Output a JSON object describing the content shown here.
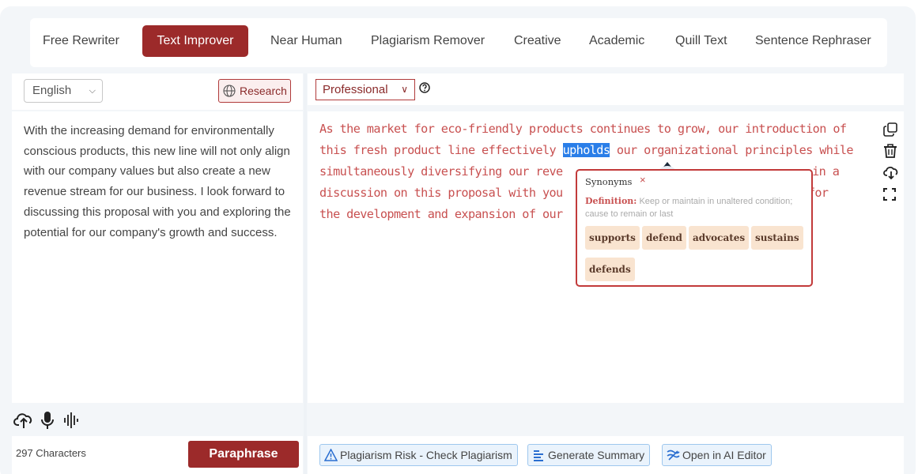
{
  "tabs": [
    {
      "label": "Free Rewriter",
      "active": false
    },
    {
      "label": "Text Improver",
      "active": true
    },
    {
      "label": "Near Human",
      "active": false
    },
    {
      "label": "Plagiarism Remover",
      "active": false
    },
    {
      "label": "Creative",
      "active": false
    },
    {
      "label": "Academic",
      "active": false
    },
    {
      "label": "Quill Text",
      "active": false
    },
    {
      "label": "Sentence Rephraser",
      "active": false
    }
  ],
  "left": {
    "language": "English",
    "research_label": "Research",
    "input_text": "With the increasing demand for environmentally conscious products, this new line will not only align with our company values but also create a new revenue stream for our business. I look forward to discussing this proposal with you and exploring the potential for our company's growth and success.",
    "char_count": "297 Characters",
    "paraphrase_label": "Paraphrase",
    "icons": [
      "upload-cloud-icon",
      "microphone-icon",
      "audio-wave-icon"
    ]
  },
  "right": {
    "tone": "Professional",
    "output": {
      "line1": "As the market for eco-friendly products continues to grow, our introduction of",
      "line2_a": "this fresh product line effectively ",
      "highlighted": "upholds",
      "line2_b": " our organizational principles while",
      "line3_a": "simultaneously diversifying our reve",
      "line3_b": " in a",
      "line4_a": "discussion on this proposal with you",
      "line4_b": "ities for",
      "line5": "the development and expansion of our"
    },
    "side_icons": [
      "copy-icon",
      "trash-icon",
      "download-icon",
      "fullscreen-icon"
    ],
    "actions": {
      "plagiarism": "Plagiarism Risk - Check Plagiarism",
      "summary": "Generate Summary",
      "editor": "Open in AI Editor"
    }
  },
  "popup": {
    "title": "Synonyms",
    "close": "×",
    "definition_label": "Definition:",
    "definition_text": "Keep or maintain in unaltered condition; cause to remain or last",
    "synonyms": [
      "supports",
      "defend",
      "advocates",
      "sustains",
      "defends"
    ]
  },
  "colors": {
    "brand": "#9c2a2a",
    "output_text": "#c85050",
    "highlight": "#2a7ee8",
    "synonym_chip": "#f9e4d0"
  }
}
